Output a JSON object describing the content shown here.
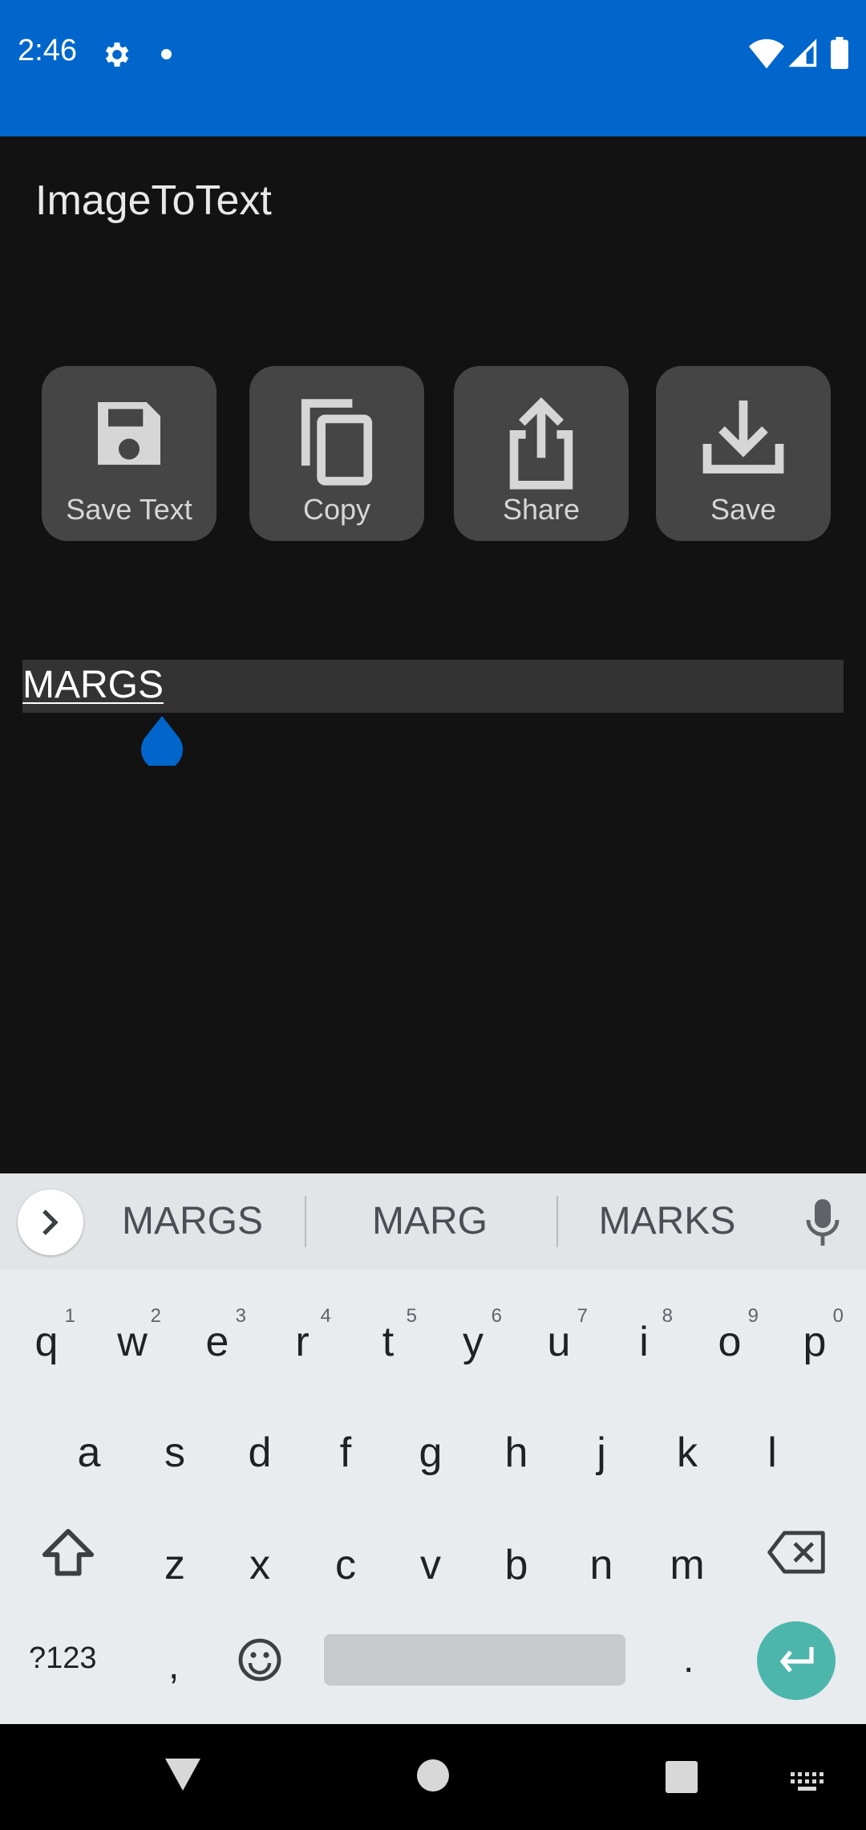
{
  "status_bar": {
    "time": "2:46",
    "color": "#0066CC",
    "icons": [
      "gear-icon",
      "dot-icon",
      "wifi-icon",
      "signal-icon",
      "battery-icon"
    ]
  },
  "app": {
    "title": "ImageToText"
  },
  "actions": [
    {
      "label": "Save Text",
      "icon": "floppy-disk-icon"
    },
    {
      "label": "Copy",
      "icon": "copy-icon"
    },
    {
      "label": "Share",
      "icon": "share-icon"
    },
    {
      "label": "Save",
      "icon": "download-icon"
    }
  ],
  "text_field": {
    "value": "MARGS",
    "accent": "#0066CC"
  },
  "keyboard": {
    "suggestions": [
      "MARGS",
      "MARG",
      "MARKS"
    ],
    "row1": [
      {
        "key": "q",
        "hint": "1"
      },
      {
        "key": "w",
        "hint": "2"
      },
      {
        "key": "e",
        "hint": "3"
      },
      {
        "key": "r",
        "hint": "4"
      },
      {
        "key": "t",
        "hint": "5"
      },
      {
        "key": "y",
        "hint": "6"
      },
      {
        "key": "u",
        "hint": "7"
      },
      {
        "key": "i",
        "hint": "8"
      },
      {
        "key": "o",
        "hint": "9"
      },
      {
        "key": "p",
        "hint": "0"
      }
    ],
    "row2": [
      "a",
      "s",
      "d",
      "f",
      "g",
      "h",
      "j",
      "k",
      "l"
    ],
    "row3": [
      "z",
      "x",
      "c",
      "v",
      "b",
      "n",
      "m"
    ],
    "symbols_label": "?123",
    "comma": ",",
    "period": ".",
    "enter_color": "#4db6ac"
  }
}
